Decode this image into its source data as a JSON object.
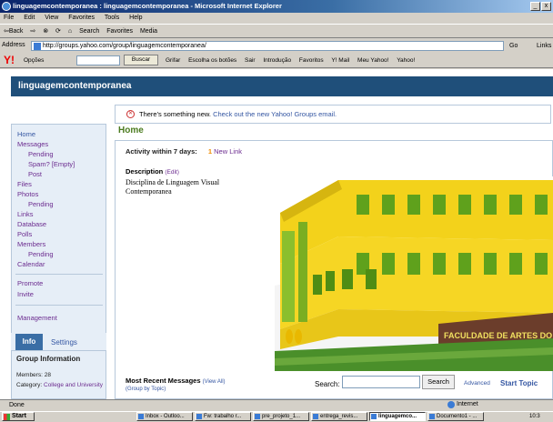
{
  "window": {
    "title": "linguagemcontemporanea : linguagemcontemporanea - Microsoft Internet Explorer",
    "minimize": "_",
    "close": "x"
  },
  "menu": [
    "File",
    "Edit",
    "View",
    "Favorites",
    "Tools",
    "Help"
  ],
  "toolbar": [
    "⇦Back",
    "⇨",
    "⊗",
    "⟳",
    "⌂",
    "Search",
    "Favorites",
    "Media"
  ],
  "address": {
    "label": "Address",
    "url": "http://groups.yahoo.com/group/linguagemcontemporanea/",
    "go": "Go",
    "links": "Links"
  },
  "yahoo_bar": {
    "logo": "Y!",
    "options": "Opções",
    "buscar": "Buscar",
    "items": [
      "Grifar",
      "Escolha os botões",
      "Sair",
      "Introdução",
      "Favoritos",
      "Y! Mail",
      "Meu Yahoo!",
      "Yahoo!"
    ]
  },
  "group": {
    "name": "linguagemcontemporanea"
  },
  "nav": {
    "home": "Home",
    "messages": "Messages",
    "pending": "Pending",
    "spam": "Spam?  [Empty]",
    "post": "Post",
    "files": "Files",
    "photos": "Photos",
    "photos_pending": "Pending",
    "links": "Links",
    "database": "Database",
    "polls": "Polls",
    "members": "Members",
    "members_pending": "Pending",
    "calendar": "Calendar",
    "promote": "Promote",
    "invite": "Invite",
    "management": "Management"
  },
  "info": {
    "tab_info": "Info",
    "tab_settings": "Settings",
    "heading": "Group Information",
    "members": "Members: 28",
    "category_label": "Category:",
    "category_value": "College and University"
  },
  "notice": {
    "text": "There's something new.",
    "link": "Check out the new Yahoo! Groups email."
  },
  "main": {
    "title": "Home",
    "activity_label": "Activity within 7 days:",
    "activity_count": "1",
    "activity_link": "New Link",
    "description_label": "Description",
    "edit": "(Edit)",
    "description": "Disciplina de Linguagem Visual Contemporanea",
    "building_sign": "FACULDADE DE ARTES DO PARANÁ",
    "recent_label": "Most Recent Messages",
    "view_all": "(View All)",
    "group_by_topic": "(Group by Topic)",
    "search_label": "Search:",
    "search_button": "Search",
    "advanced": "Advanced",
    "start_topic": "Start Topic"
  },
  "status": {
    "left": "Done",
    "zone": "Internet"
  },
  "taskbar": {
    "start": "Start",
    "tasks": [
      "Inbox - Outloo...",
      "Fw: trabalho r...",
      "pre_projeto_1...",
      "entrega_revis...",
      "linguagemco...",
      "Documento1 - ..."
    ],
    "clock": "10:3"
  }
}
